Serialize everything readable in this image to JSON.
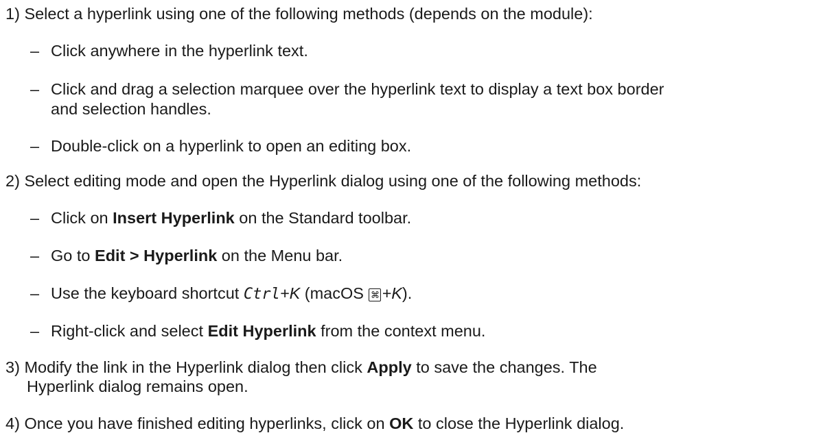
{
  "steps": [
    {
      "num": "1)",
      "text": "Select a hyperlink using one of the following methods (depends on the module):",
      "subs": [
        {
          "dash": "–",
          "text": "Click anywhere in the hyperlink text."
        },
        {
          "dash": "–",
          "text": "Click and drag a selection marquee over the hyperlink text to display a text box border",
          "cont": "and selection handles."
        },
        {
          "dash": "–",
          "text": "Double-click on a hyperlink to open an editing box."
        }
      ]
    },
    {
      "num": "2)",
      "text": "Select editing mode and open the Hyperlink dialog using one of the following methods:",
      "subs": [
        {
          "dash": "–",
          "pre": "Click on ",
          "bold": "Insert Hyperlink",
          "post": " on the Standard toolbar."
        },
        {
          "dash": "–",
          "pre": "Go to ",
          "bold": "Edit > Hyperlink",
          "post": " on the Menu bar."
        },
        {
          "dash": "–",
          "pre": "Use the keyboard shortcut ",
          "key1": "Ctrl",
          "plus1": "+",
          "key2": "K",
          "mid": " (macOS ",
          "cmd_symbol": "⌘",
          "plus2": "+",
          "key3": "K",
          "post": ")."
        },
        {
          "dash": "–",
          "pre": "Right-click and select ",
          "bold": "Edit Hyperlink",
          "post": " from the context menu."
        }
      ]
    },
    {
      "num": "3)",
      "pre": "Modify the link in the Hyperlink dialog then click ",
      "bold": "Apply",
      "post": " to save the changes. The",
      "cont": "Hyperlink dialog remains open."
    },
    {
      "num": "4)",
      "pre": "Once you have finished editing hyperlinks, click on ",
      "bold": "OK",
      "post": " to close the Hyperlink dialog."
    }
  ]
}
